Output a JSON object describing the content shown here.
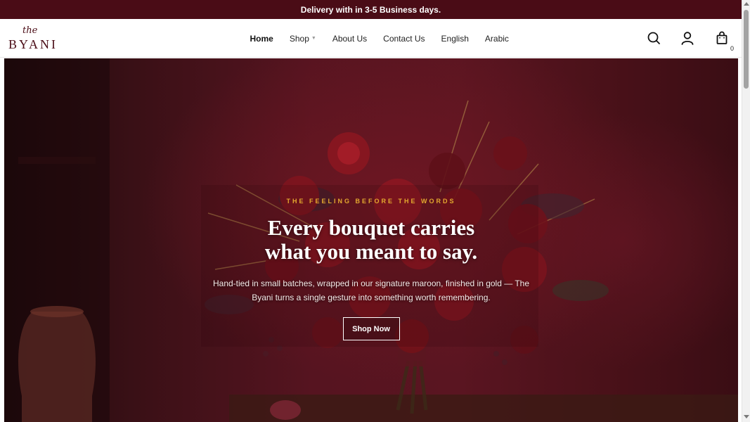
{
  "announcement": {
    "text": "Delivery with in 3-5 Business days."
  },
  "logo": {
    "script": "the",
    "wordmark": "BYANI"
  },
  "nav": {
    "items": [
      {
        "label": "Home",
        "active": true
      },
      {
        "label": "Shop",
        "has_dropdown": true
      },
      {
        "label": "About Us"
      },
      {
        "label": "Contact Us"
      },
      {
        "label": "English"
      },
      {
        "label": "Arabic"
      }
    ]
  },
  "header_icons": {
    "search": "search-icon",
    "account": "user-icon",
    "cart": "shopping-bag-icon",
    "cart_count": "0"
  },
  "hero": {
    "eyebrow": "THE FEELING BEFORE THE WORDS",
    "headline_line1": "Every bouquet carries",
    "headline_line2": "what you meant to say.",
    "subtext": "Hand-tied in small batches, wrapped in our signature maroon, finished in gold — The Byani turns a single gesture into something worth remembering.",
    "cta_label": "Shop Now"
  },
  "colors": {
    "brand_maroon": "#4a0c16",
    "gold_accent": "#e3a92f",
    "hero_background": "#561420"
  }
}
